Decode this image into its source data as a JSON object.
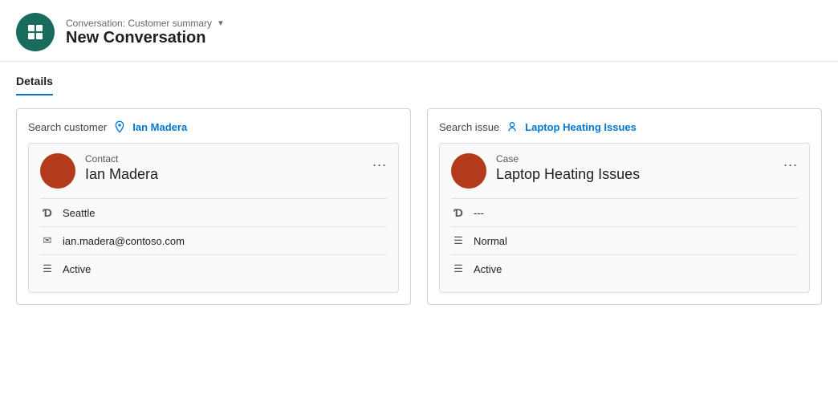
{
  "header": {
    "breadcrumb": "Conversation: Customer summary",
    "title": "New Conversation",
    "icon_label": "conversation-icon"
  },
  "tabs": [
    {
      "label": "Details",
      "active": true
    }
  ],
  "customer_panel": {
    "search_label": "Search customer",
    "search_value": "Ian Madera",
    "card": {
      "type": "Contact",
      "name": "Ian Madera",
      "menu_label": "...",
      "details": [
        {
          "icon": "D",
          "value": "Seattle"
        },
        {
          "icon": "✉",
          "value": "ian.madera@contoso.com"
        },
        {
          "icon": "≡",
          "value": "Active"
        }
      ]
    }
  },
  "issue_panel": {
    "search_label": "Search issue",
    "search_value": "Laptop Heating Issues",
    "card": {
      "type": "Case",
      "name": "Laptop Heating Issues",
      "menu_label": "...",
      "details": [
        {
          "icon": "D",
          "value": "---"
        },
        {
          "icon": "≡",
          "value": "Normal"
        },
        {
          "icon": "≡",
          "value": "Active"
        }
      ]
    }
  }
}
